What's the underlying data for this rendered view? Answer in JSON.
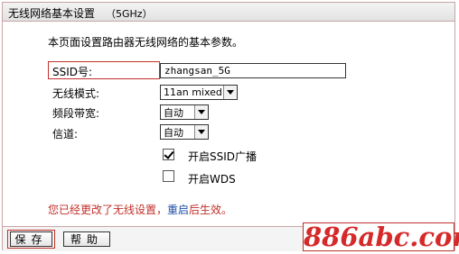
{
  "header": {
    "title": "无线网络基本设置",
    "subtitle": "（5GHz）"
  },
  "main": {
    "description": "本页面设置路由器无线网络的基本参数。",
    "ssid": {
      "label": "SSID号:",
      "value": "zhangsan_5G"
    },
    "mode": {
      "label": "无线模式:",
      "value": "11an mixed"
    },
    "bandwidth": {
      "label": "频段带宽:",
      "value": "自动"
    },
    "channel": {
      "label": "信道:",
      "value": "自动"
    },
    "ssid_broadcast": {
      "label": "开启SSID广播",
      "checked": true
    },
    "wds": {
      "label": "开启WDS",
      "checked": false
    },
    "notice": {
      "text": "您已经更改了无线设置，",
      "link": "重启",
      "suffix": "后生效。"
    }
  },
  "footer": {
    "save_label": "保存",
    "help_label": "帮助"
  },
  "watermark": "886abc.com",
  "colors": {
    "highlight_border": "#c0302a",
    "notice_text": "#c0302a",
    "link": "#1f4fa6"
  }
}
